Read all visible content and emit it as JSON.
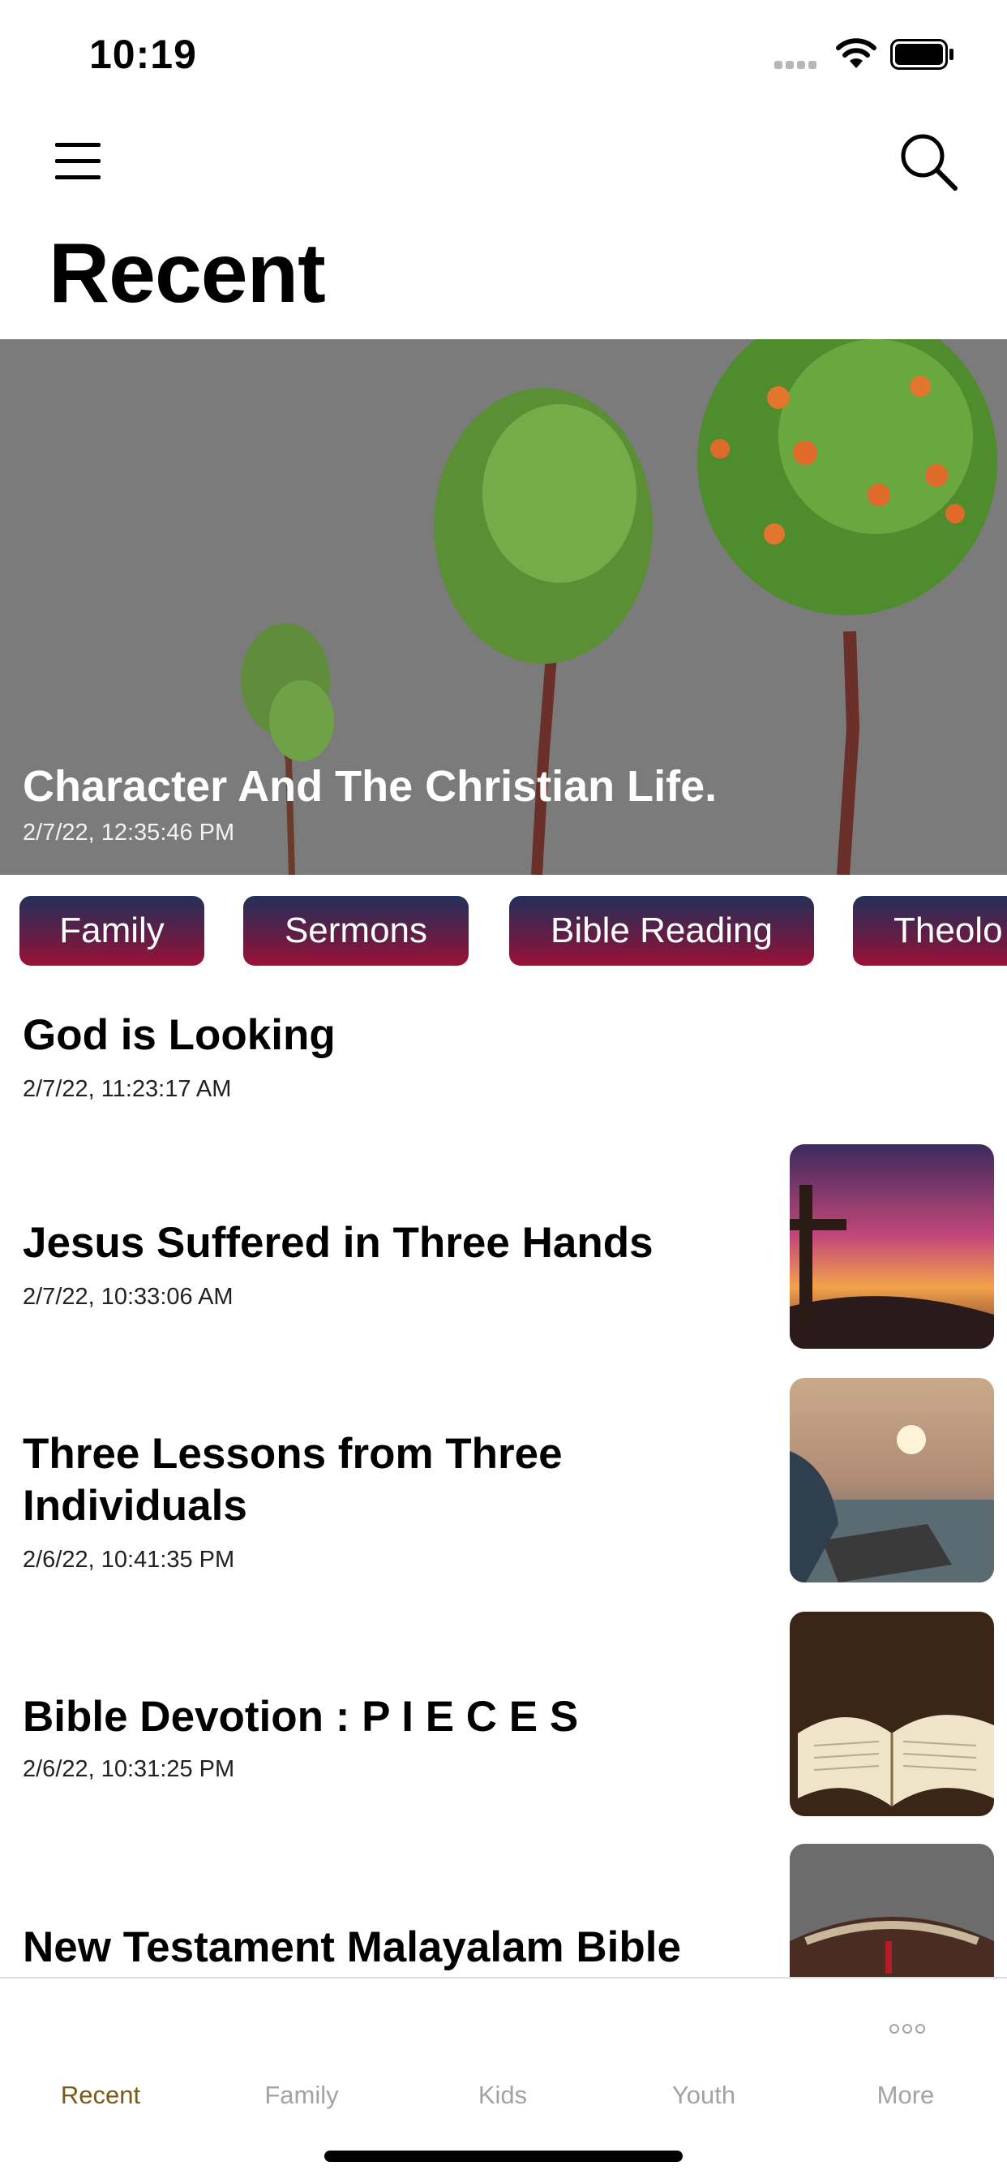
{
  "status_bar": {
    "time": "10:19"
  },
  "header": {
    "title": "Recent"
  },
  "hero": {
    "title": "Character And The Christian Life.",
    "date": "2/7/22, 12:35:46 PM"
  },
  "categories": [
    "Family",
    "Sermons",
    "Bible Reading",
    "Theolo"
  ],
  "articles": [
    {
      "title": "God is Looking",
      "date": "2/7/22, 11:23:17 AM"
    },
    {
      "title": "Jesus Suffered in Three Hands",
      "date": "2/7/22, 10:33:06 AM"
    },
    {
      "title": "Three Lessons from Three Individuals",
      "date": "2/6/22, 10:41:35 PM"
    },
    {
      "title": "Bible Devotion : P I E C E S",
      "date": "2/6/22, 10:31:25 PM"
    },
    {
      "title": "New Testament Malayalam Bible",
      "date": ""
    }
  ],
  "tabs": [
    {
      "label": "Recent"
    },
    {
      "label": "Family"
    },
    {
      "label": "Kids"
    },
    {
      "label": "Youth"
    },
    {
      "label": "More"
    }
  ],
  "colors": {
    "accent": "#7a5a12",
    "chip_top": "#23305a",
    "chip_bottom": "#9d1238"
  }
}
